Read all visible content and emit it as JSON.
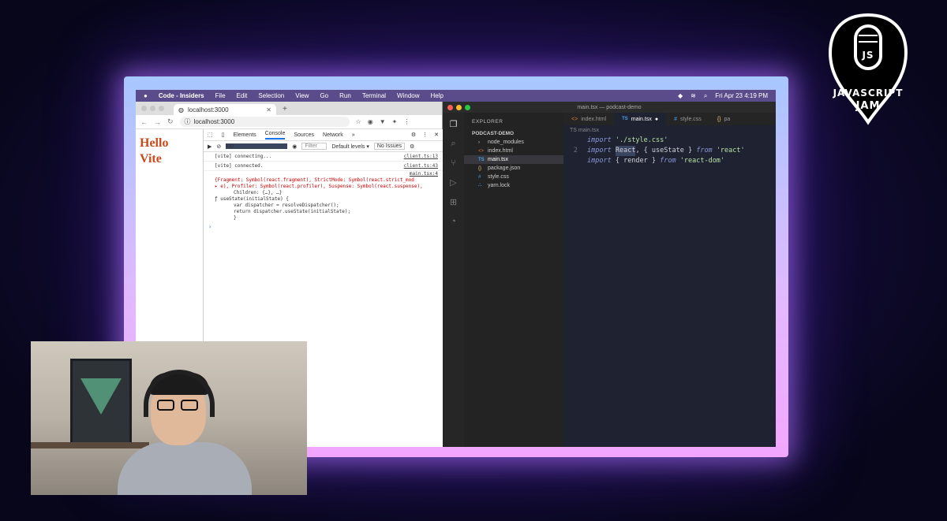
{
  "menubar": {
    "app_name": "Code - Insiders",
    "items": [
      "File",
      "Edit",
      "Selection",
      "View",
      "Go",
      "Run",
      "Terminal",
      "Window",
      "Help"
    ],
    "clock": "Fri Apr 23  4:19 PM"
  },
  "browser": {
    "tab_title": "localhost:3000",
    "url": "localhost:3000",
    "page_heading_line1": "Hello",
    "page_heading_line2": "Vite"
  },
  "devtools": {
    "tabs": [
      "Elements",
      "Console",
      "Sources",
      "Network",
      "»"
    ],
    "active_tab": "Console",
    "context": "top",
    "filter_placeholder": "Filter",
    "levels": "Default levels ▾",
    "issues": "No Issues",
    "logs": [
      {
        "text": "[vite] connecting...",
        "source": "client.ts:13"
      },
      {
        "text": "[vite] connected.",
        "source": "client.ts:43"
      }
    ],
    "obj_source": "main.tsx:4",
    "obj_line1": "{Fragment: Symbol(react.fragment), StrictMode: Symbol(react.strict_mod",
    "obj_line2": "▸ e), Profiler: Symbol(react.profiler), Suspense: Symbol(react.suspense),",
    "obj_line3": "Children: {…}, …}",
    "fn_line1": "ƒ useState(initialState) {",
    "fn_line2": "var dispatcher = resolveDispatcher();",
    "fn_line3": "return dispatcher.useState(initialState);",
    "fn_line4": "}",
    "prompt": "›"
  },
  "vscode": {
    "window_title": "main.tsx — podcast-demo",
    "explorer_label": "EXPLORER",
    "project": "PODCAST-DEMO",
    "files": [
      {
        "name": "node_modules",
        "icon": "›"
      },
      {
        "name": "index.html",
        "icon": "<>"
      },
      {
        "name": "main.tsx",
        "icon": "TS"
      },
      {
        "name": "package.json",
        "icon": "{}"
      },
      {
        "name": "style.css",
        "icon": "#"
      },
      {
        "name": "yarn.lock",
        "icon": "⛬"
      }
    ],
    "tabs": [
      "index.html",
      "main.tsx",
      "style.css",
      "pa"
    ],
    "breadcrumb": "TS main.tsx",
    "code": {
      "l1_kw": "import",
      "l1_str": "'./style.css'",
      "l2_num": "2",
      "l2_kw": "import",
      "l2_sel": "React",
      "l2_rest": ", { useState } ",
      "l2_from": "from",
      "l2_str": "'react'",
      "l3_kw": "import",
      "l3_rest": " { render } ",
      "l3_from": "from",
      "l3_str": "'react-dom'"
    }
  },
  "logo": {
    "line1": "JAVASCRIPT",
    "line2": "JAM",
    "mark": "JS"
  }
}
